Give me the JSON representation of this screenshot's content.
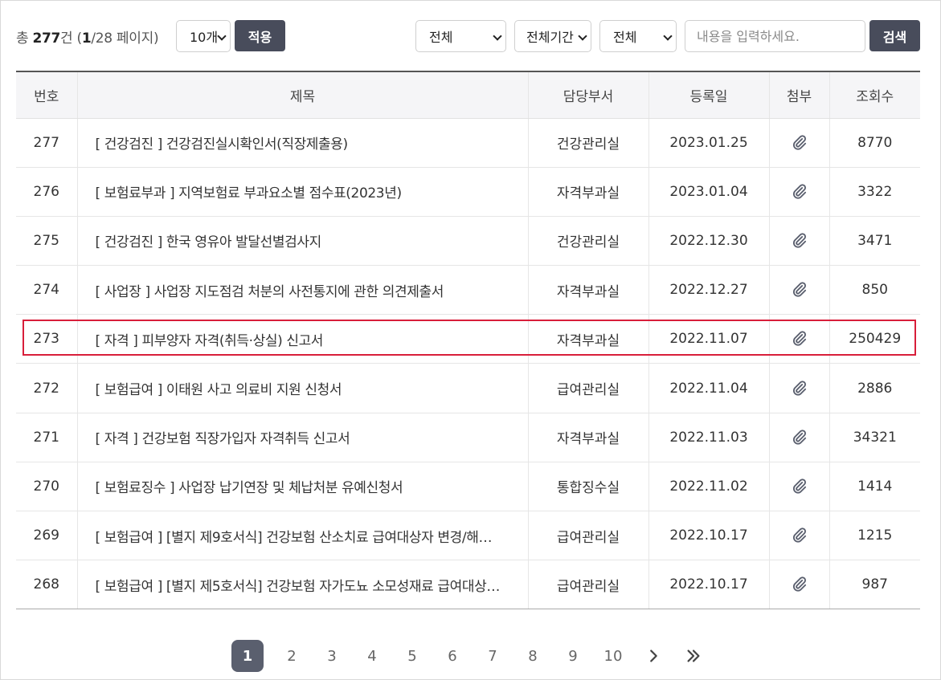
{
  "summary": {
    "prefix": "총 ",
    "total": "277",
    "unit": "건 (",
    "page": "1",
    "pages": "/28 페이지)"
  },
  "controls": {
    "per_page": "10개",
    "apply_label": "적용",
    "filter1": "전체",
    "filter2": "전체기간",
    "filter3": "전체",
    "search_placeholder": "내용을 입력하세요.",
    "search_label": "검색"
  },
  "table": {
    "headers": [
      "번호",
      "제목",
      "담당부서",
      "등록일",
      "첨부",
      "조회수"
    ],
    "rows": [
      {
        "no": "277",
        "title": "[ 건강검진 ] 건강검진실시확인서(직장제출용)",
        "dept": "건강관리실",
        "date": "2023.01.25",
        "attach": "paperclip-icon",
        "views": "8770"
      },
      {
        "no": "276",
        "title": "[ 보험료부과 ] 지역보험료 부과요소별 점수표(2023년)",
        "dept": "자격부과실",
        "date": "2023.01.04",
        "attach": "paperclip-icon",
        "views": "3322"
      },
      {
        "no": "275",
        "title": "[ 건강검진 ] 한국 영유아 발달선별검사지",
        "dept": "건강관리실",
        "date": "2022.12.30",
        "attach": "paperclip-icon",
        "views": "3471"
      },
      {
        "no": "274",
        "title": "[ 사업장 ] 사업장 지도점검 처분의 사전통지에 관한 의견제출서",
        "dept": "자격부과실",
        "date": "2022.12.27",
        "attach": "paperclip-icon",
        "views": "850"
      },
      {
        "no": "273",
        "title": "[ 자격 ] 피부양자 자격(취득·상실) 신고서",
        "dept": "자격부과실",
        "date": "2022.11.07",
        "attach": "paperclip-icon",
        "views": "250429"
      },
      {
        "no": "272",
        "title": "[ 보험급여 ] 이태원 사고 의료비 지원 신청서",
        "dept": "급여관리실",
        "date": "2022.11.04",
        "attach": "paperclip-icon",
        "views": "2886"
      },
      {
        "no": "271",
        "title": "[ 자격 ] 건강보험 직장가입자 자격취득 신고서",
        "dept": "자격부과실",
        "date": "2022.11.03",
        "attach": "paperclip-icon",
        "views": "34321"
      },
      {
        "no": "270",
        "title": "[ 보험료징수 ] 사업장 납기연장 및 체납처분 유예신청서",
        "dept": "통합징수실",
        "date": "2022.11.02",
        "attach": "paperclip-icon",
        "views": "1414"
      },
      {
        "no": "269",
        "title": "[ 보험급여 ] [별지 제9호서식] 건강보험 산소치료 급여대상자 변경/해…",
        "dept": "급여관리실",
        "date": "2022.10.17",
        "attach": "paperclip-icon",
        "views": "1215"
      },
      {
        "no": "268",
        "title": "[ 보험급여 ] [별지 제5호서식] 건강보험 자가도뇨 소모성재료 급여대상…",
        "dept": "급여관리실",
        "date": "2022.10.17",
        "attach": "paperclip-icon",
        "views": "987"
      }
    ]
  },
  "highlight_row": "273",
  "highlight_color": "#d81e3a",
  "pagination": {
    "pages": [
      "1",
      "2",
      "3",
      "4",
      "5",
      "6",
      "7",
      "8",
      "9",
      "10"
    ],
    "current": "1",
    "next_icon": "chevron-right-icon",
    "last_icon": "double-chevron-right-icon"
  }
}
